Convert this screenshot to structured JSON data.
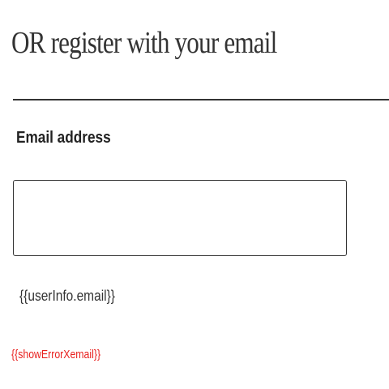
{
  "form": {
    "heading": "OR register with your email",
    "email_label": "Email address",
    "email_value": "",
    "email_placeholder": "",
    "bound_email_text": "{{userInfo.email}}",
    "error_text": "{{showErrorXemail}}"
  },
  "colors": {
    "text": "#333333",
    "error": "#e8201e"
  }
}
